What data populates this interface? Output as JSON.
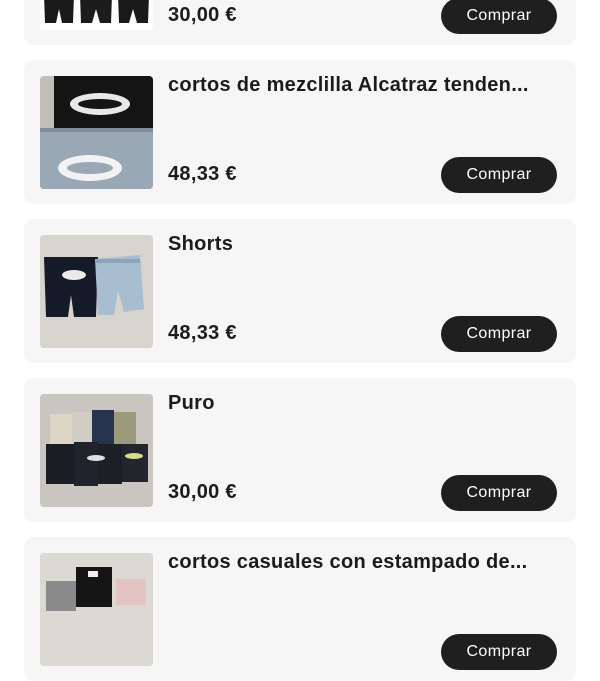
{
  "products": [
    {
      "title": "",
      "price": "30,00 €",
      "button": "Comprar",
      "image_icon": "black-shorts-trio-image"
    },
    {
      "title": "cortos de mezclilla Alcatraz tenden...",
      "price": "48,33 €",
      "button": "Comprar",
      "image_icon": "denim-shorts-logo-image"
    },
    {
      "title": "Shorts",
      "price": "48,33 €",
      "button": "Comprar",
      "image_icon": "two-shorts-image"
    },
    {
      "title": "Puro",
      "price": "30,00 €",
      "button": "Comprar",
      "image_icon": "cargo-shorts-grid-image"
    },
    {
      "title": "cortos casuales con estampado de...",
      "price": "",
      "button": "Comprar",
      "image_icon": "printed-shorts-image"
    }
  ],
  "colors": {
    "card_bg": "#f6f6f6",
    "button_bg": "#1f1f1f",
    "button_text": "#ffffff",
    "text": "#1b1b1b"
  }
}
